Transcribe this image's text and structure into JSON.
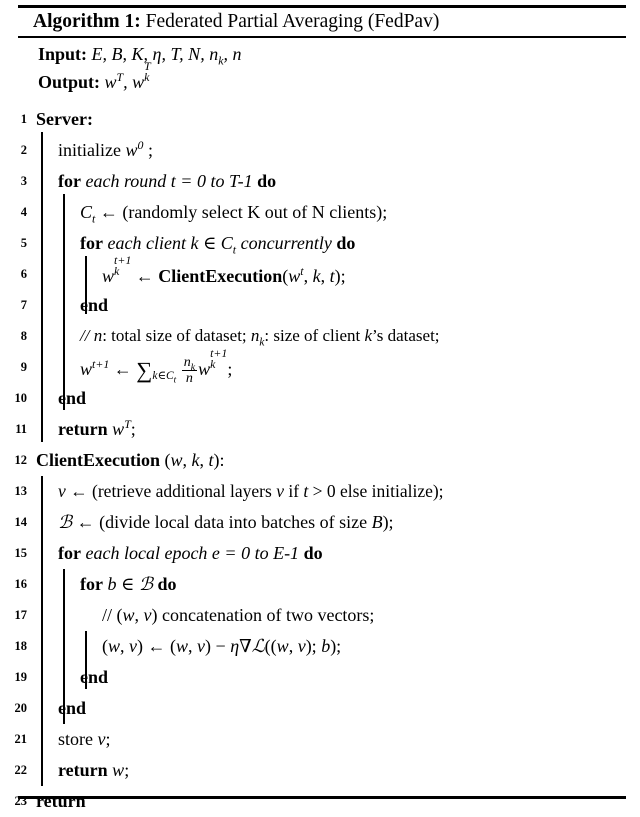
{
  "caption": {
    "label": "Algorithm 1:",
    "title": "Federated Partial Averaging (FedPav)"
  },
  "io": {
    "input_label": "Input:",
    "input_value": "E, B, K, η, T, N, nₖ, n",
    "output_label": "Output:",
    "output_value": "wᵀ, wₖᵀ"
  },
  "lines": [
    {
      "no": "1",
      "indent": 0,
      "text": "Server:"
    },
    {
      "no": "2",
      "indent": 1,
      "text": "initialize w⁰ ;"
    },
    {
      "no": "3",
      "indent": 1,
      "text": "for each round t = 0 to T-1 do"
    },
    {
      "no": "4",
      "indent": 2,
      "text": "Cₜ ← (randomly select K out of N clients);"
    },
    {
      "no": "5",
      "indent": 2,
      "text": "for each client k ∈ Cₜ concurrently do"
    },
    {
      "no": "6",
      "indent": 3,
      "text": "wₖᵗ⁺¹ ← ClientExecution(wᵗ, k, t);"
    },
    {
      "no": "7",
      "indent": 2,
      "text": "end"
    },
    {
      "no": "8",
      "indent": 2,
      "text": "// n: total size of dataset; nₖ: size of client k's dataset;"
    },
    {
      "no": "9",
      "indent": 2,
      "text": "wᵗ⁺¹ ← ∑ₖ∈Cₜ (nₖ/n) wₖᵗ⁺¹;"
    },
    {
      "no": "10",
      "indent": 1,
      "text": "end"
    },
    {
      "no": "11",
      "indent": 1,
      "text": "return wᵀ;"
    },
    {
      "no": "12",
      "indent": 0,
      "text": "ClientExecution (w, k, t):"
    },
    {
      "no": "13",
      "indent": 1,
      "text": "v ← (retrieve additional layers v if t > 0 else initialize);"
    },
    {
      "no": "14",
      "indent": 1,
      "text": "ℬ ← (divide local data into batches of size B);"
    },
    {
      "no": "15",
      "indent": 1,
      "text": "for each local epoch e = 0 to E-1 do"
    },
    {
      "no": "16",
      "indent": 2,
      "text": "for b ∈ ℬ do"
    },
    {
      "no": "17",
      "indent": 3,
      "text": "// (w, v) concatenation of two vectors;"
    },
    {
      "no": "18",
      "indent": 3,
      "text": "(w, v) ← (w, v) − η∇ℒ((w, v); b);"
    },
    {
      "no": "19",
      "indent": 2,
      "text": "end"
    },
    {
      "no": "20",
      "indent": 1,
      "text": "end"
    },
    {
      "no": "21",
      "indent": 1,
      "text": "store v;"
    },
    {
      "no": "22",
      "indent": 1,
      "text": "return w;"
    },
    {
      "no": "23",
      "indent": 0,
      "text": "return"
    }
  ],
  "tokens": {
    "kw_for": "for",
    "kw_do": "do",
    "kw_end": "end",
    "kw_return": "return",
    "kw_server": "Server:",
    "kw_client_execution": "ClientExecution",
    "line2_text": "initialize",
    "line3_text": "each round t = 0 to T-1",
    "line4_text": "(randomly select K out of N clients);",
    "line5_text": "each client k",
    "line5_text2": "concurrently",
    "line6_args": "(w",
    "line6_args2": ", k, t);",
    "line8_text1": "// n",
    "line8_text2": ": total size of dataset; n",
    "line8_text3": ": size of client k’s dataset;",
    "line12_args": "(w, k, t):",
    "line13_text": "(retrieve additional layers v if t > 0 else initialize);",
    "line14_text": "(divide local data into batches of size B);",
    "line15_text": "each local epoch e = 0 to E-1",
    "line16_text": "b",
    "line17_text": "// (w, v) concatenation of two vectors;",
    "line18_text": "(w, v) ← (w, v) − η∇ℒ((w, v); b);",
    "line21_text": "store",
    "arrow": "←",
    "in_sym": "∈",
    "sum_sym": "∑",
    "minus": "−",
    "nabla": "∇"
  },
  "colors": {
    "text": "#000000",
    "background": "#ffffff",
    "rule": "#000000"
  }
}
